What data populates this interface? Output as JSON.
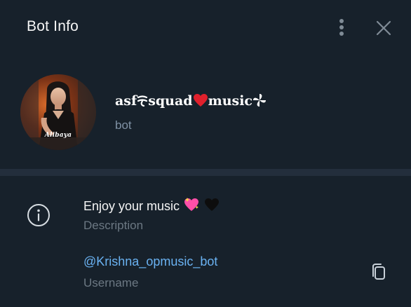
{
  "header": {
    "title": "Bot Info",
    "more_icon": "vertical-dots-icon",
    "close_icon": "close-icon"
  },
  "profile": {
    "avatar_caption": "Alibaya",
    "name_prefix": "asf",
    "name_mid": "squad",
    "name_suffix": "music",
    "name_symbols": [
      "sparkle-glyph",
      "red-heart",
      "pinwheel-glyph"
    ],
    "subtitle": "bot"
  },
  "description": {
    "value": "Enjoy your music",
    "value_emojis": [
      "sparkling-heart",
      "black-heart"
    ],
    "label": "Description",
    "icon": "info-icon"
  },
  "username": {
    "value": "@Krishna_opmusic_bot",
    "label": "Username",
    "copy_icon": "copy-icon"
  },
  "colors": {
    "background": "#17212b",
    "divider": "#232e3c",
    "secondary_text": "#6c7883",
    "link": "#6ab2f2",
    "heart_red": "#e0202c",
    "sparkle_pink": "#ff4fa8"
  }
}
